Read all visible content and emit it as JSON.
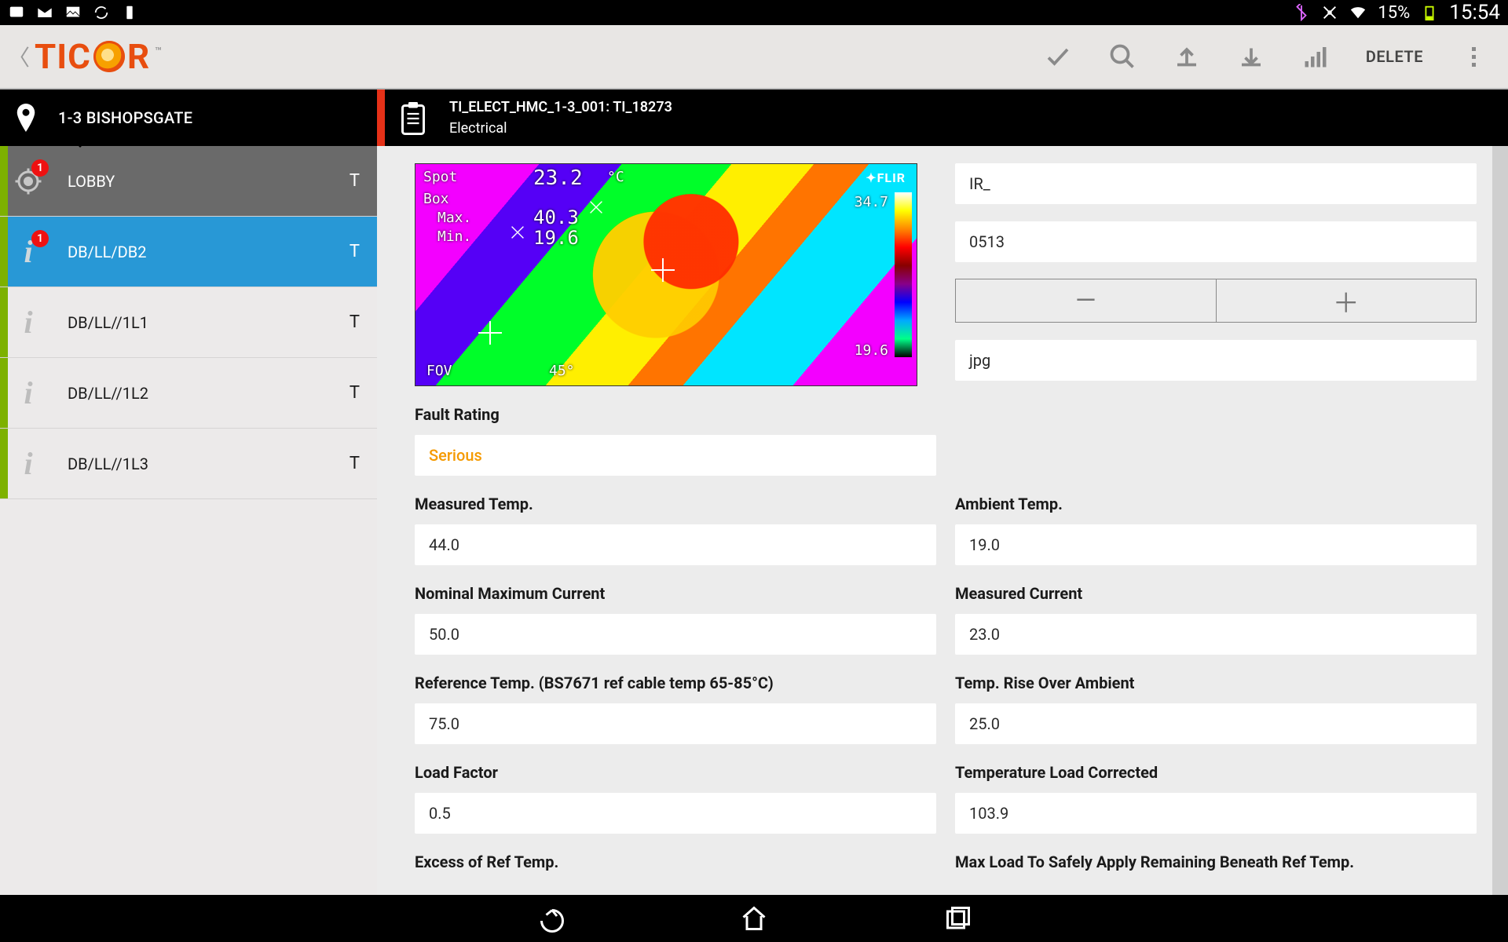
{
  "status": {
    "battery_pct": "15%",
    "time": "15:54"
  },
  "brand": {
    "pre": "TIC",
    "post": "R"
  },
  "toolbar": {
    "delete": "DELETE"
  },
  "location": {
    "name": "1-3 BISHOPSGATE"
  },
  "sidebar": {
    "items": [
      {
        "label": "LOBBY",
        "t": "T",
        "badge": "1"
      },
      {
        "label": "DB/LL/DB2",
        "t": "T",
        "badge": "1"
      },
      {
        "label": "DB/LL//1L1",
        "t": "T"
      },
      {
        "label": "DB/LL//1L2",
        "t": "T"
      },
      {
        "label": "DB/LL//1L3",
        "t": "T"
      }
    ]
  },
  "doc": {
    "title": "TI_ELECT_HMC_1-3_001: TI_18273",
    "category": "Electrical"
  },
  "thermal": {
    "spot_lbl": "Spot",
    "box_lbl": "Box",
    "max_lbl": "Max.",
    "min_lbl": "Min.",
    "spot": "23.2",
    "max": "40.3",
    "min": "19.6",
    "unit": "°C",
    "scale_hi": "34.7",
    "scale_lo": "19.6",
    "fov_lbl": "FOV",
    "fov": "45°",
    "brand": "FLIR"
  },
  "inputs": {
    "prefix": "IR_",
    "num": "0513",
    "ext": "jpg"
  },
  "form": {
    "fault_rating_lbl": "Fault Rating",
    "fault_rating_val": "Serious",
    "measured_temp_lbl": "Measured Temp.",
    "measured_temp_val": "44.0",
    "ambient_temp_lbl": "Ambient Temp.",
    "ambient_temp_val": "19.0",
    "nom_max_current_lbl": "Nominal Maximum Current",
    "nom_max_current_val": "50.0",
    "measured_current_lbl": "Measured Current",
    "measured_current_val": "23.0",
    "ref_temp_lbl": "Reference Temp. (BS7671 ref cable temp 65-85°C)",
    "ref_temp_val": "75.0",
    "rise_over_ambient_lbl": "Temp. Rise Over Ambient",
    "rise_over_ambient_val": "25.0",
    "load_factor_lbl": "Load Factor",
    "load_factor_val": "0.5",
    "temp_load_corr_lbl": "Temperature Load Corrected",
    "temp_load_corr_val": "103.9",
    "excess_ref_lbl": "Excess of Ref Temp.",
    "max_load_safe_lbl": "Max Load To Safely Apply Remaining Beneath Ref Temp."
  }
}
